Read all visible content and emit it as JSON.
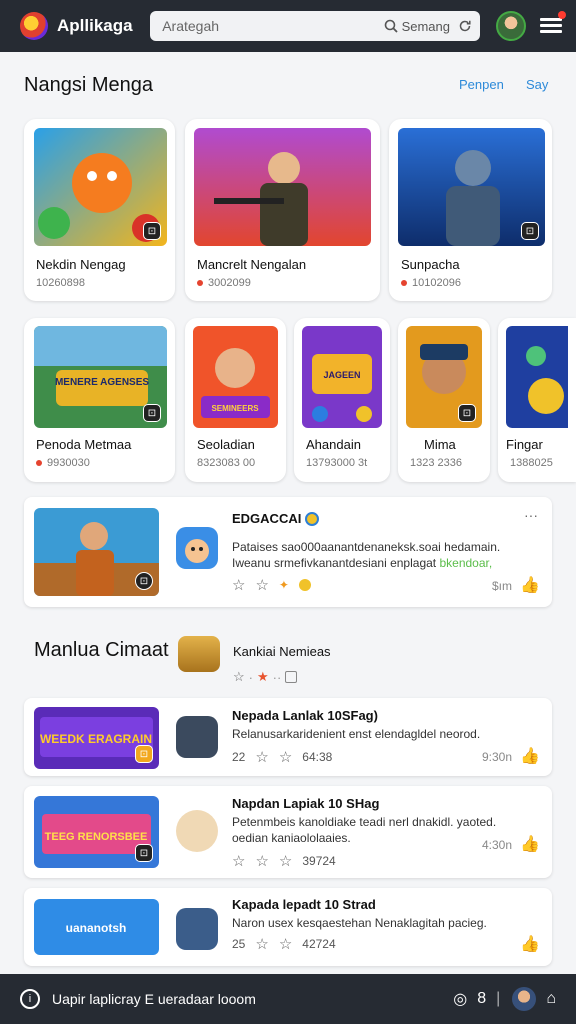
{
  "header": {
    "app_title": "Apllikaga",
    "search_placeholder": "Arategah",
    "search_button": "Semang",
    "icons": [
      "app-logo",
      "search-icon",
      "refresh-icon",
      "menu-icon"
    ]
  },
  "featured_section": {
    "title": "Nangsi Menga",
    "link_1": "Penpen",
    "link_2": "Say"
  },
  "featured_row1": [
    {
      "name": "Nekdin Nengag",
      "meta": "10260898"
    },
    {
      "name": "Mancrelt Nengalan",
      "meta": "3002099"
    },
    {
      "name": "Sunpacha",
      "meta": "10102096"
    }
  ],
  "featured_row2": [
    {
      "name": "Penoda Metmaa",
      "meta": "9930030",
      "thumb_text": "MENERE AGENSES"
    },
    {
      "name": "Seoladian",
      "meta": "8323083 00",
      "thumb_text": "SEMINEERS"
    },
    {
      "name": "Ahandain",
      "meta": "13793000 3t",
      "thumb_text": "JAGEEN"
    },
    {
      "name": "Mima",
      "meta": "1323 2336"
    },
    {
      "name": "Fingar",
      "meta": "1388025"
    }
  ],
  "promo": {
    "title": "EDGACCAI",
    "description": "Pataises sao000aanantdenaneksk.soai hedamain. Iweanu srmefivkanantdesiani enplagat",
    "highlight": "bkendoar,",
    "time": "$ım",
    "more": "···"
  },
  "list_section": {
    "title": "Manlua Cimaat",
    "sub_title": "Kankiai Nemieas"
  },
  "list_items": [
    {
      "thumb_text": "WEEDK ERAGRAIN",
      "title": "Nepada Lanlak 10SFag)",
      "description": "Relanusarkaridenient enst elendagldel neorod.",
      "count_a": "22",
      "count_b": "64:38",
      "time": "9:30n"
    },
    {
      "thumb_text": "TEEG RENORSBEE",
      "title": "Napdan Lapiak 10 SHag",
      "description": "Petenmbeis kanoldiake teadi nerl dnakidl. yaoted. oedian kaniaololaaies.",
      "count_a": "",
      "count_b": "39724",
      "time": "4:30n"
    },
    {
      "thumb_text": "uananotsh",
      "title": "Kapada lepadt 10 Strad",
      "description": "Naron usex kesqaestehan Nenaklagitah pacieg.",
      "count_a": "25",
      "count_b": "42724",
      "time": ""
    }
  ],
  "footer": {
    "text": "Uapir laplicray E ueradaar looom",
    "count": "8"
  }
}
